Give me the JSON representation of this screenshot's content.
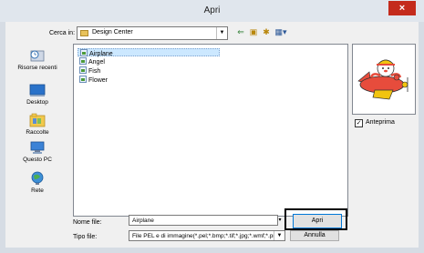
{
  "window": {
    "title": "Apri",
    "close_glyph": "×"
  },
  "lookin": {
    "label": "Cerca in:",
    "value": "Design Center",
    "folder_icon": "folder-icon"
  },
  "toolbar": {
    "back_glyph": "⇐",
    "up_glyph": "▣",
    "new_folder_glyph": "✱",
    "view_glyph": "▦▾"
  },
  "places": [
    {
      "label": "Risorse recenti",
      "icon": "recent-places-icon"
    },
    {
      "label": "Desktop",
      "icon": "desktop-icon"
    },
    {
      "label": "Raccolte",
      "icon": "libraries-icon"
    },
    {
      "label": "Questo PC",
      "icon": "computer-icon"
    },
    {
      "label": "Rete",
      "icon": "network-icon"
    }
  ],
  "files": [
    {
      "name": "Airplane",
      "selected": true
    },
    {
      "name": "Angel",
      "selected": false
    },
    {
      "name": "Fish",
      "selected": false
    },
    {
      "name": "Flower",
      "selected": false
    }
  ],
  "preview": {
    "checkbox_label": "Anteprima",
    "checked": true,
    "check_glyph": "✓"
  },
  "filename": {
    "label": "Nome file:",
    "value": "Airplane"
  },
  "filetype": {
    "label": "Tipo file:",
    "value": "File PEL e di immagine(*.pel;*.bmp;*.tif;*.jpg;*.wmf;*.pr"
  },
  "buttons": {
    "open": "Apri",
    "cancel": "Annulla"
  },
  "colors": {
    "close_button": "#c42b1c",
    "selection": "#cce8ff",
    "highlight_box": "#000000"
  }
}
